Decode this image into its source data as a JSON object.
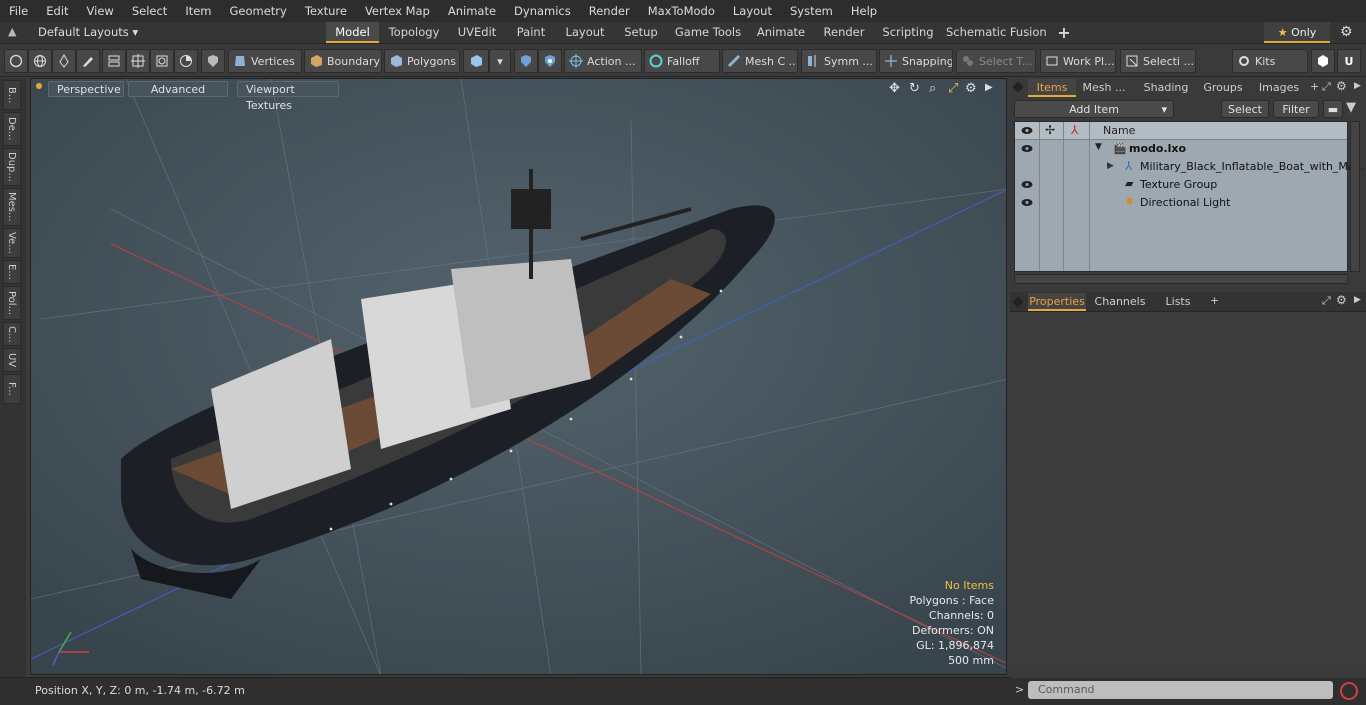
{
  "menu": [
    "File",
    "Edit",
    "View",
    "Select",
    "Item",
    "Geometry",
    "Texture",
    "Vertex Map",
    "Animate",
    "Dynamics",
    "Render",
    "MaxToModo",
    "Layout",
    "System",
    "Help"
  ],
  "layoutbar": {
    "layout_dropdown": "Default Layouts",
    "tabs": [
      "Model",
      "Topology",
      "UVEdit",
      "Paint",
      "Layout",
      "Setup",
      "Game Tools",
      "Animate",
      "Render",
      "Scripting",
      "Schematic Fusion"
    ],
    "active_tab": "Model",
    "add": "+",
    "only": "Only"
  },
  "toolbar": {
    "vertices": "Vertices",
    "boundary": "Boundary",
    "polygons": "Polygons",
    "action": "Action ...",
    "falloff": "Falloff",
    "mesh": "Mesh C ...",
    "symm": "Symm ...",
    "snapping": "Snapping",
    "select_t": "Select T...",
    "work_pl": "Work Pl...",
    "selecti": "Selecti ...",
    "kits": "Kits"
  },
  "leftstrip": [
    "B...",
    "De...",
    "Dup...",
    "Mes...",
    "Ve...",
    "E...",
    "Pol...",
    "C...",
    "UV",
    "F..."
  ],
  "viewport": {
    "perspective": "Perspective",
    "advanced": "Advanced",
    "viewport_textures": "Viewport Textures",
    "info": {
      "no_items": "No Items",
      "polygons": "Polygons : Face",
      "channels": "Channels: 0",
      "deformers": "Deformers: ON",
      "gl": "GL: 1,896,874",
      "scale": "500 mm"
    }
  },
  "status": {
    "position_label": "Position X, Y, Z:",
    "position_value": "0 m, -1.74 m, -6.72 m"
  },
  "items_panel": {
    "tabs": [
      "Items",
      "Mesh ...",
      "Shading",
      "Groups",
      "Images"
    ],
    "active_tab": "Items",
    "add_item": "Add Item",
    "select": "Select",
    "filter": "Filter",
    "column_name": "Name",
    "tree": [
      {
        "label": "modo.lxo",
        "bold": true
      },
      {
        "label": "Military_Black_Inflatable_Boat_with_Ma ..."
      },
      {
        "label": "Texture Group"
      },
      {
        "label": "Directional Light"
      }
    ]
  },
  "properties_panel": {
    "tabs": [
      "Properties",
      "Channels",
      "Lists"
    ],
    "active_tab": "Properties",
    "add": "+"
  },
  "command": {
    "placeholder": "Command",
    "prompt": ">"
  },
  "colors": {
    "accent": "#e4a93c",
    "viewport_bg": "#4b5a64",
    "tree_bg": "#9ea8b0"
  }
}
